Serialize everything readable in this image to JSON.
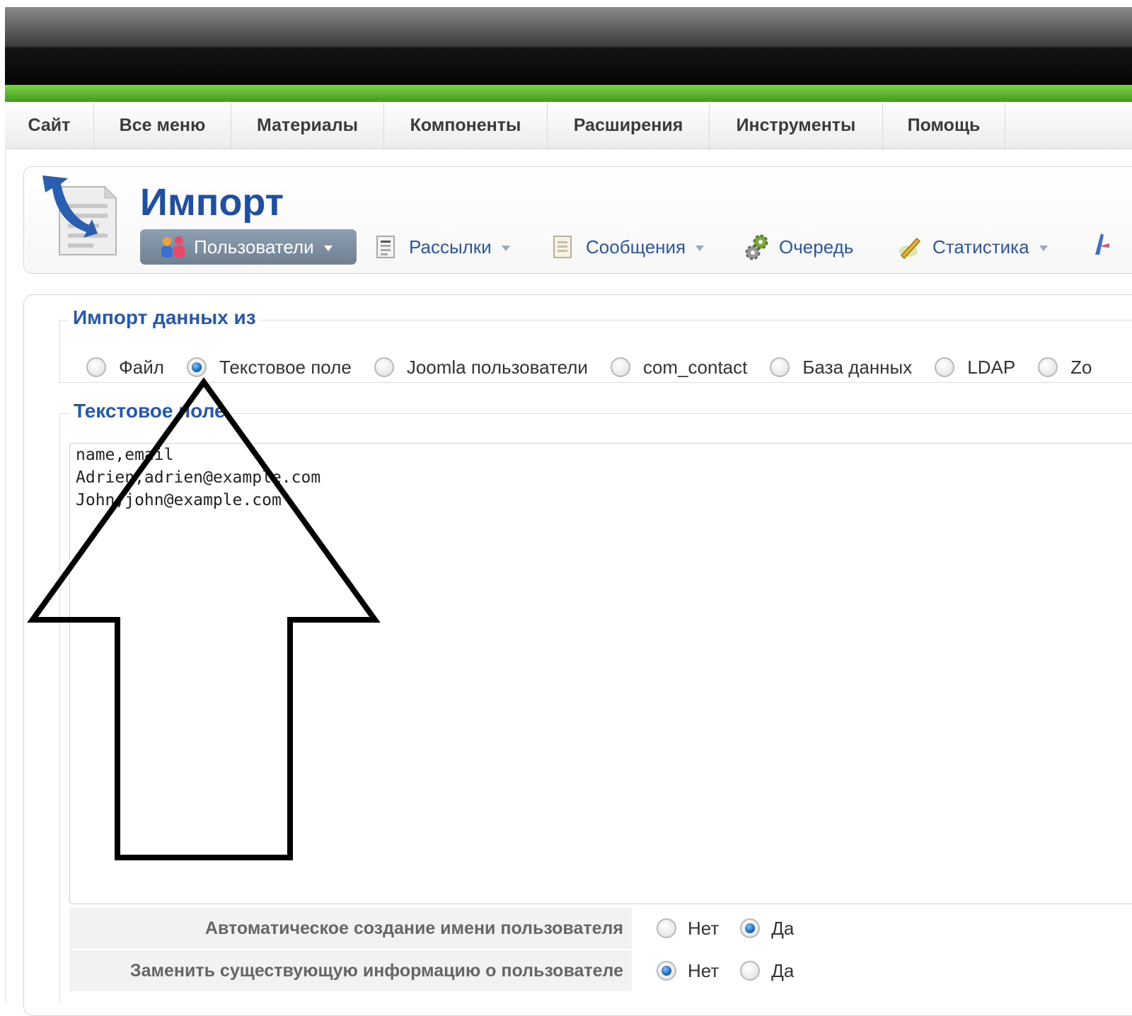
{
  "menu": {
    "items": [
      {
        "label": "Сайт"
      },
      {
        "label": "Все меню"
      },
      {
        "label": "Материалы"
      },
      {
        "label": "Компоненты"
      },
      {
        "label": "Расширения"
      },
      {
        "label": "Инструменты"
      },
      {
        "label": "Помощь"
      }
    ]
  },
  "header": {
    "title": "Импорт",
    "subnav": {
      "users": "Пользователи",
      "mailings": "Рассылки",
      "messages": "Сообщения",
      "queue": "Очередь",
      "stats": "Статистика"
    }
  },
  "import_source": {
    "legend": "Импорт данных из",
    "options": [
      {
        "label": "Файл",
        "selected": false
      },
      {
        "label": "Текстовое поле",
        "selected": true
      },
      {
        "label": "Joomla пользователи",
        "selected": false
      },
      {
        "label": "com_contact",
        "selected": false
      },
      {
        "label": "База данных",
        "selected": false
      },
      {
        "label": "LDAP",
        "selected": false
      },
      {
        "label": "Zo",
        "selected": false
      }
    ]
  },
  "textfield": {
    "legend": "Текстовое поле",
    "value": "name,email\nAdrien,adrien@example.com\nJohn,john@example.com"
  },
  "options": [
    {
      "label": "Автоматическое создание имени пользователя",
      "no": "Нет",
      "yes": "Да",
      "selected": "yes"
    },
    {
      "label": "Заменить существующую информацию о пользователе",
      "no": "Нет",
      "yes": "Да",
      "selected": "no"
    }
  ],
  "colors": {
    "accent_blue": "#2358b5",
    "green_bar": "#5cb531",
    "active_tab": "#7d8fa2"
  }
}
